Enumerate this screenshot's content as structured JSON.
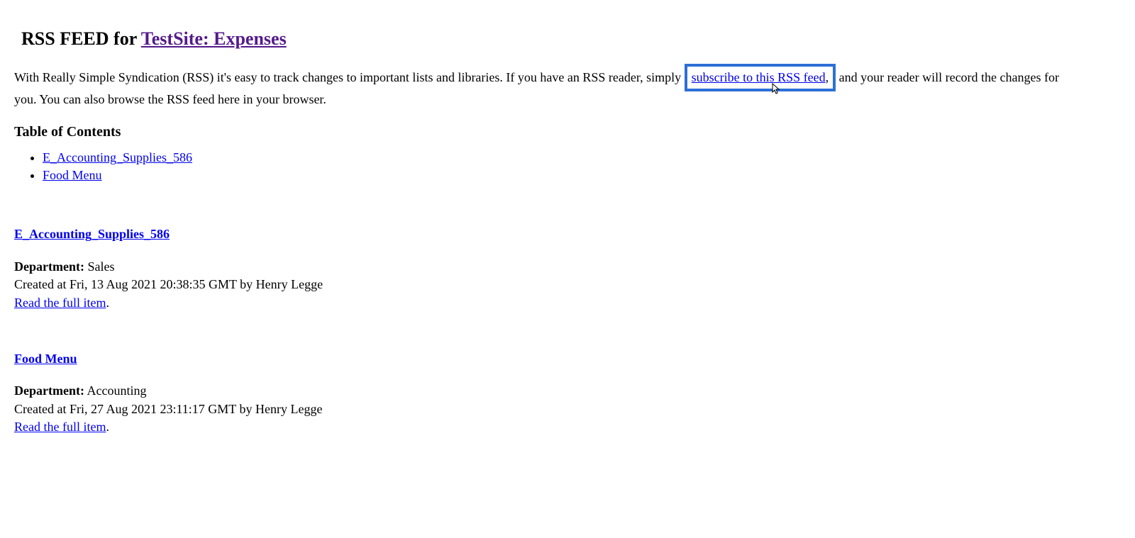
{
  "header": {
    "prefix": "RSS FEED for ",
    "site_link": "TestSite: Expenses"
  },
  "intro": {
    "part1": "With Really Simple Syndication (RSS) it's easy to track changes to important lists and libraries. If you have an RSS reader, simply ",
    "subscribe_link": "subscribe to this RSS feed",
    "comma": ", ",
    "part2": "and your reader will record the changes for you. You can also browse the RSS feed here in your browser."
  },
  "toc": {
    "heading": "Table of Contents",
    "items": [
      "E_Accounting_Supplies_586",
      "Food Menu"
    ]
  },
  "labels": {
    "department": "Department:",
    "read_full": "Read the full item",
    "dot": "."
  },
  "entries": [
    {
      "title": "E_Accounting_Supplies_586",
      "department": "Sales",
      "created": "Created at Fri, 13 Aug 2021 20:38:35 GMT by Henry Legge"
    },
    {
      "title": "Food Menu",
      "department": "Accounting",
      "created": "Created at Fri, 27 Aug 2021 23:11:17 GMT by Henry Legge"
    }
  ]
}
